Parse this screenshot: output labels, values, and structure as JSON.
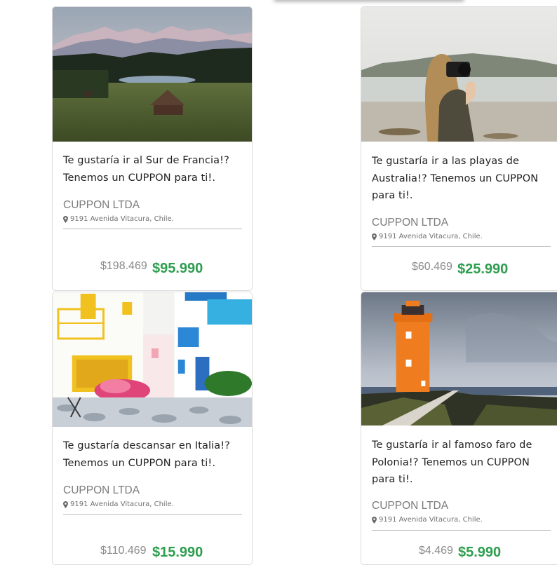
{
  "cards": [
    {
      "title": "Te gustaría ir al Sur de Francia!? Tenemos un CUPPON para ti!.",
      "company": "CUPPON LTDA",
      "address": "9191 Avenida Vitacura, Chile.",
      "old_price": "$198.469",
      "new_price": "$95.990",
      "image": "mountain-lake-cabin-photo"
    },
    {
      "title": "Te gustaría ir a las playas de Australia!? Tenemos un CUPPON para ti!.",
      "company": "CUPPON LTDA",
      "address": "9191 Avenida Vitacura, Chile.",
      "old_price": "$60.469",
      "new_price": "$25.990",
      "image": "beach-photographer-photo"
    },
    {
      "title": "Te gustaría descansar en Italia!? Tenemos un CUPPON para ti!.",
      "company": "CUPPON LTDA",
      "address": "9191 Avenida Vitacura, Chile.",
      "old_price": "$110.469",
      "new_price": "$15.990",
      "image": "colorful-courtyard-photo"
    },
    {
      "title": "Te gustaría ir al famoso faro de Polonia!? Tenemos un CUPPON para ti!.",
      "company": "CUPPON LTDA",
      "address": "9191 Avenida Vitacura, Chile.",
      "old_price": "$4.469",
      "new_price": "$5.990",
      "image": "orange-lighthouse-photo"
    }
  ],
  "colors": {
    "price_green": "#2e9e4f",
    "muted_text": "#7b7b7b",
    "card_border": "#dcdcdc"
  }
}
